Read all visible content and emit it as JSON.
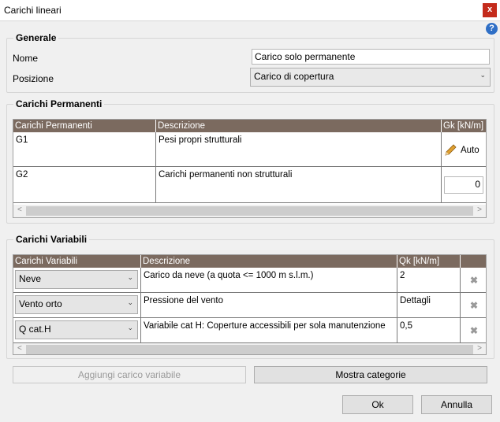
{
  "window": {
    "title": "Carichi lineari",
    "close_glyph": "x",
    "help_glyph": "?"
  },
  "generale": {
    "title": "Generale",
    "nome_label": "Nome",
    "nome_value": "Carico solo permanente",
    "posizione_label": "Posizione",
    "posizione_value": "Carico di copertura"
  },
  "permanenti": {
    "title": "Carichi Permanenti",
    "columns": [
      "Carichi Permanenti",
      "Descrizione",
      "Gk [kN/m]"
    ],
    "rows": [
      {
        "name": "G1",
        "desc": "Pesi propri strutturali",
        "value": "Auto"
      },
      {
        "name": "G2",
        "desc": "Carichi permanenti non strutturali",
        "value": "0"
      }
    ]
  },
  "variabili": {
    "title": "Carichi Variabili",
    "columns": [
      "Carichi Variabili",
      "Descrizione",
      "Qk [kN/m]",
      ""
    ],
    "rows": [
      {
        "name": "Neve",
        "desc": "Carico da neve (a quota <= 1000 m s.l.m.)",
        "value": "2"
      },
      {
        "name": "Vento orto",
        "desc": "Pressione del vento",
        "value": "Dettagli"
      },
      {
        "name": "Q cat.H",
        "desc": "Variabile cat H: Coperture accessibili per sola manutenzione",
        "value": "0,5"
      }
    ]
  },
  "buttons": {
    "aggiungi": "Aggiungi carico variabile",
    "mostra": "Mostra categorie",
    "ok": "Ok",
    "annulla": "Annulla"
  }
}
